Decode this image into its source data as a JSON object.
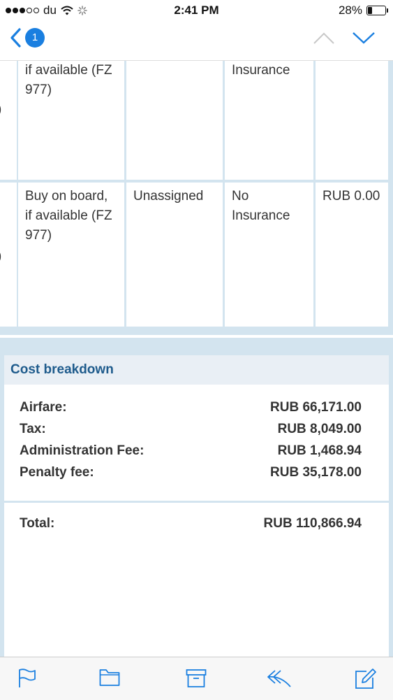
{
  "status_bar": {
    "carrier": "du",
    "time": "2:41 PM",
    "battery": "28%",
    "battery_level": 0.28
  },
  "nav": {
    "unread_count": "1"
  },
  "table": {
    "row1": {
      "c1": [
        "if available (FZ",
        "977)"
      ],
      "c2": "",
      "c3": "Insurance",
      "c4": "",
      "edge": ")"
    },
    "row2": {
      "c1": [
        "Buy on board,",
        "if available (FZ",
        "977)"
      ],
      "c2": "Unassigned",
      "c3": [
        "No",
        "Insurance"
      ],
      "c4": "RUB 0.00",
      "edge": ")"
    }
  },
  "cost": {
    "title": "Cost breakdown",
    "rows": [
      {
        "label": "Airfare:",
        "value": "RUB 66,171.00"
      },
      {
        "label": "Tax:",
        "value": "RUB 8,049.00"
      },
      {
        "label": "Administration Fee:",
        "value": "RUB 1,468.94"
      },
      {
        "label": "Penalty fee:",
        "value": "RUB 35,178.00"
      }
    ],
    "total": {
      "label": "Total:",
      "value": "RUB 110,866.94"
    }
  },
  "colors": {
    "accent": "#1a7fe0",
    "header_text": "#1e5b8c",
    "page_bg": "#d3e4ef"
  },
  "toolbar_icons": [
    "flag-icon",
    "folder-icon",
    "archive-icon",
    "reply-icon",
    "compose-icon"
  ]
}
